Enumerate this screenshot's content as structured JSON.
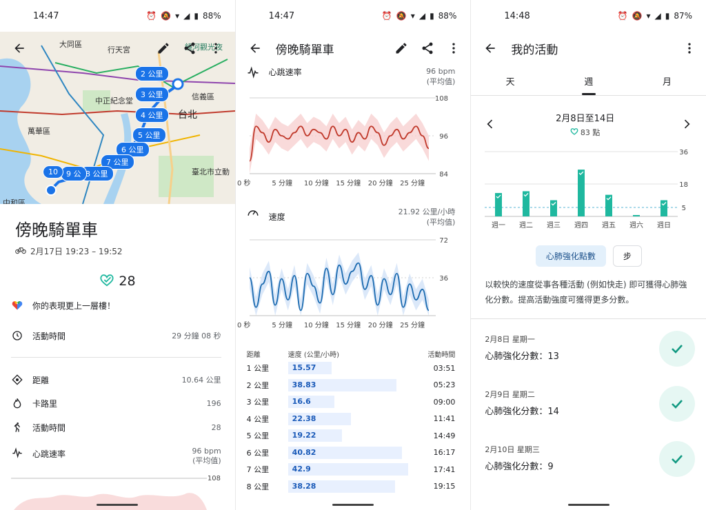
{
  "colors": {
    "accent": "#1a73e8",
    "heart_line": "#c0392b",
    "heart_band": "#f7cdcd",
    "speed_line": "#1c6bb0",
    "speed_band": "#cfe0f7",
    "teal": "#1fb89f",
    "teal_dark": "#129a82"
  },
  "screen1": {
    "time": "14:47",
    "battery": "88%",
    "map": {
      "labels": [
        "大同區",
        "行天宮",
        "萬華區",
        "中正紀念堂",
        "台北",
        "信義區",
        "臺北市立動",
        "中和區",
        "饒河觀光夜"
      ],
      "km_pins": [
        "2 公里",
        "3 公里",
        "4 公里",
        "5 公里",
        "6 公里",
        "7 公里",
        "8 公里",
        "9 公",
        "10"
      ]
    },
    "title": "傍晚騎單車",
    "date": "2月17日 19:23 – 19:52",
    "score": "28",
    "message": "你的表現更上一層樓！",
    "active_time_label": "活動時間",
    "active_time_value": "29 分鐘 08 秒",
    "stats": [
      {
        "icon": "location-diamond-icon",
        "label": "距離",
        "value": "10.64 公里"
      },
      {
        "icon": "flame-icon",
        "label": "卡路里",
        "value": "196"
      },
      {
        "icon": "walking-person-icon",
        "label": "活動時間",
        "value": "28"
      }
    ],
    "heart_label": "心跳速率",
    "heart_value": "96 bpm",
    "heart_sub": "(平均值)",
    "tick_108": "108"
  },
  "screen2": {
    "time": "14:47",
    "battery": "88%",
    "title": "傍晚騎單車",
    "heart": {
      "label": "心跳速率",
      "value": "96 bpm",
      "sub": "(平均值)",
      "yticks": [
        "108",
        "96",
        "84"
      ],
      "xticks": [
        "0 秒",
        "5 分鐘",
        "10 分鐘",
        "15 分鐘",
        "20 分鐘",
        "25 分鐘"
      ]
    },
    "speed": {
      "label": "速度",
      "value": "21.92 公里/小時",
      "sub": "(平均值)",
      "yticks": [
        "72",
        "36"
      ],
      "xticks": [
        "0 秒",
        "5 分鐘",
        "10 分鐘",
        "15 分鐘",
        "20 分鐘",
        "25 分鐘"
      ]
    },
    "splits": {
      "headers": [
        "距離",
        "速度 (公里/小時)",
        "活動時間"
      ],
      "max_speed": 45,
      "rows": [
        {
          "dist": "1 公里",
          "speed": 15.57,
          "speed_label": "15.57",
          "time": "03:51"
        },
        {
          "dist": "2 公里",
          "speed": 38.83,
          "speed_label": "38.83",
          "time": "05:23"
        },
        {
          "dist": "3 公里",
          "speed": 16.6,
          "speed_label": "16.6",
          "time": "09:00"
        },
        {
          "dist": "4 公里",
          "speed": 22.38,
          "speed_label": "22.38",
          "time": "11:41"
        },
        {
          "dist": "5 公里",
          "speed": 19.22,
          "speed_label": "19.22",
          "time": "14:49"
        },
        {
          "dist": "6 公里",
          "speed": 40.82,
          "speed_label": "40.82",
          "time": "16:17"
        },
        {
          "dist": "7 公里",
          "speed": 42.9,
          "speed_label": "42.9",
          "time": "17:41"
        },
        {
          "dist": "8 公里",
          "speed": 38.28,
          "speed_label": "38.28",
          "time": "19:15"
        }
      ]
    }
  },
  "screen3": {
    "time": "14:48",
    "battery": "87%",
    "title": "我的活動",
    "tabs": [
      "天",
      "週",
      "月"
    ],
    "week_range": "2月8日至14日",
    "week_points": "83 點",
    "chips": [
      "心肺強化點數",
      "步"
    ],
    "description": "以較快的速度從事各種活動 (例如快走) 即可獲得心肺強化分數。提高活動強度可獲得更多分數。",
    "days": [
      {
        "date": "2月8日 星期一",
        "score": "心肺強化分數：13"
      },
      {
        "date": "2月9日 星期二",
        "score": "心肺強化分數：14"
      },
      {
        "date": "2月10日 星期三",
        "score": "心肺強化分數：9"
      }
    ]
  },
  "chart_data": [
    {
      "type": "bar",
      "categories": [
        "週一",
        "週二",
        "週三",
        "週四",
        "週五",
        "週六",
        "週日"
      ],
      "values": [
        13,
        14,
        9,
        26,
        12,
        0,
        9
      ],
      "yticks": [
        "36",
        "18",
        "5"
      ],
      "ylim": [
        0,
        36
      ],
      "goal_line": 5,
      "title": "",
      "xlabel": "",
      "ylabel": ""
    },
    {
      "type": "line",
      "x": [
        0,
        1,
        2,
        3,
        4,
        5,
        6,
        7,
        8,
        9,
        10,
        11,
        12,
        13,
        14,
        15,
        16,
        17,
        18,
        19,
        20,
        21,
        22,
        23,
        24,
        25,
        26,
        27,
        28
      ],
      "values": [
        88,
        99,
        97,
        94,
        98,
        96,
        95,
        97,
        99,
        96,
        98,
        97,
        95,
        99,
        96,
        98,
        94,
        97,
        95,
        99,
        97,
        93,
        96,
        98,
        95,
        97,
        99,
        96,
        92
      ],
      "ylim": [
        84,
        108
      ],
      "x_unit": "分鐘"
    },
    {
      "type": "line",
      "x": [
        0,
        1,
        2,
        3,
        4,
        5,
        6,
        7,
        8,
        9,
        10,
        11,
        12,
        13,
        14,
        15,
        16,
        17,
        18,
        19,
        20,
        21,
        22,
        23,
        24,
        25,
        26,
        27,
        28
      ],
      "values": [
        36,
        8,
        30,
        42,
        10,
        35,
        15,
        38,
        5,
        40,
        28,
        12,
        45,
        20,
        48,
        30,
        42,
        50,
        25,
        38,
        10,
        35,
        20,
        40,
        8,
        30,
        15,
        25,
        5
      ],
      "ylim": [
        0,
        72
      ],
      "x_unit": "分鐘"
    }
  ]
}
